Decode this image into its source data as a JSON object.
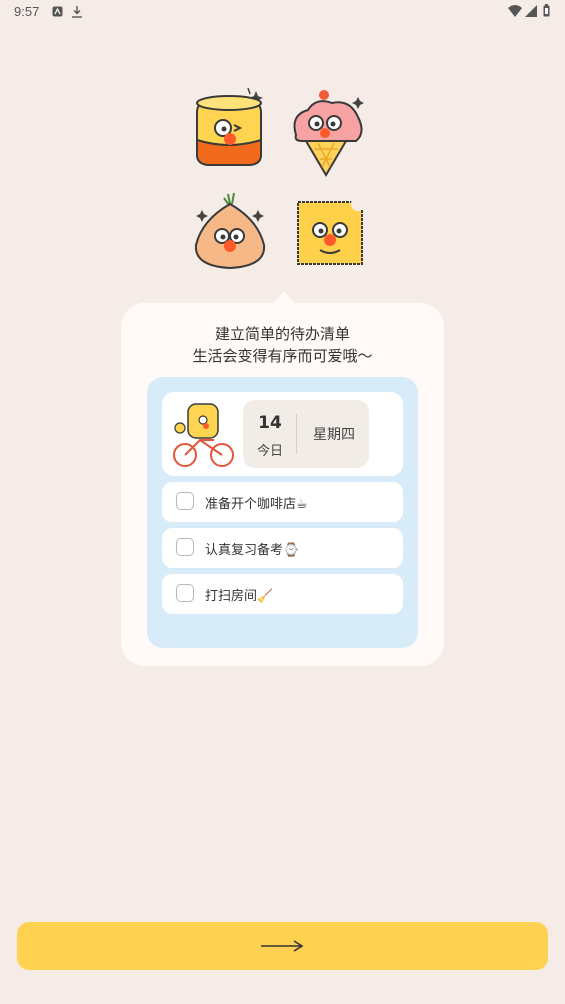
{
  "status_bar": {
    "time": "9:57"
  },
  "tagline": {
    "line1": "建立简单的待办清单",
    "line2": "生活会变得有序而可爱哦～"
  },
  "date_card": {
    "day": "14",
    "today_label": "今日",
    "weekday": "星期四"
  },
  "todos": [
    {
      "label": "准备开个咖啡店☕"
    },
    {
      "label": "认真复习备考⌚"
    },
    {
      "label": "打扫房间🧹"
    }
  ],
  "colors": {
    "background": "#f5ebe7",
    "card": "#fffaf8",
    "inner_panel": "#d8ebf9",
    "button": "#ffd151"
  },
  "icons": {
    "next_button": "arrow-right-icon"
  }
}
